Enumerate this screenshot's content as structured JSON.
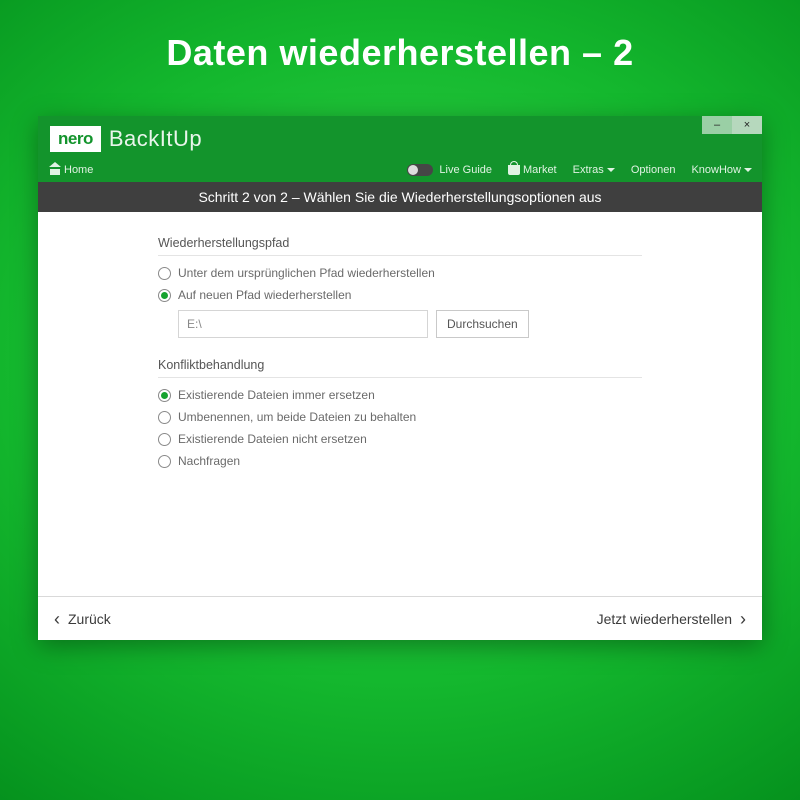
{
  "page_heading": "Daten wiederherstellen – 2",
  "brand": {
    "logo": "nero",
    "product": "BackItUp"
  },
  "window": {
    "minimize": "–",
    "close": "×"
  },
  "nav": {
    "home": "Home",
    "live_guide": "Live Guide",
    "market": "Market",
    "extras": "Extras",
    "optionen": "Optionen",
    "knowhow": "KnowHow"
  },
  "stepbar": "Schritt 2 von 2 – Wählen Sie die Wiederherstellungsoptionen aus",
  "restore_path": {
    "heading": "Wiederherstellungspfad",
    "opt_original": "Unter dem ursprünglichen Pfad wiederherstellen",
    "opt_new": "Auf neuen Pfad wiederherstellen",
    "selected": "new",
    "path_value": "E:\\",
    "browse": "Durchsuchen"
  },
  "conflict": {
    "heading": "Konfliktbehandlung",
    "opt_replace": "Existierende Dateien immer ersetzen",
    "opt_rename": "Umbenennen, um beide Dateien zu behalten",
    "opt_skip": "Existierende Dateien nicht ersetzen",
    "opt_ask": "Nachfragen",
    "selected": "replace"
  },
  "footer": {
    "back": "Zurück",
    "restore": "Jetzt wiederherstellen"
  }
}
